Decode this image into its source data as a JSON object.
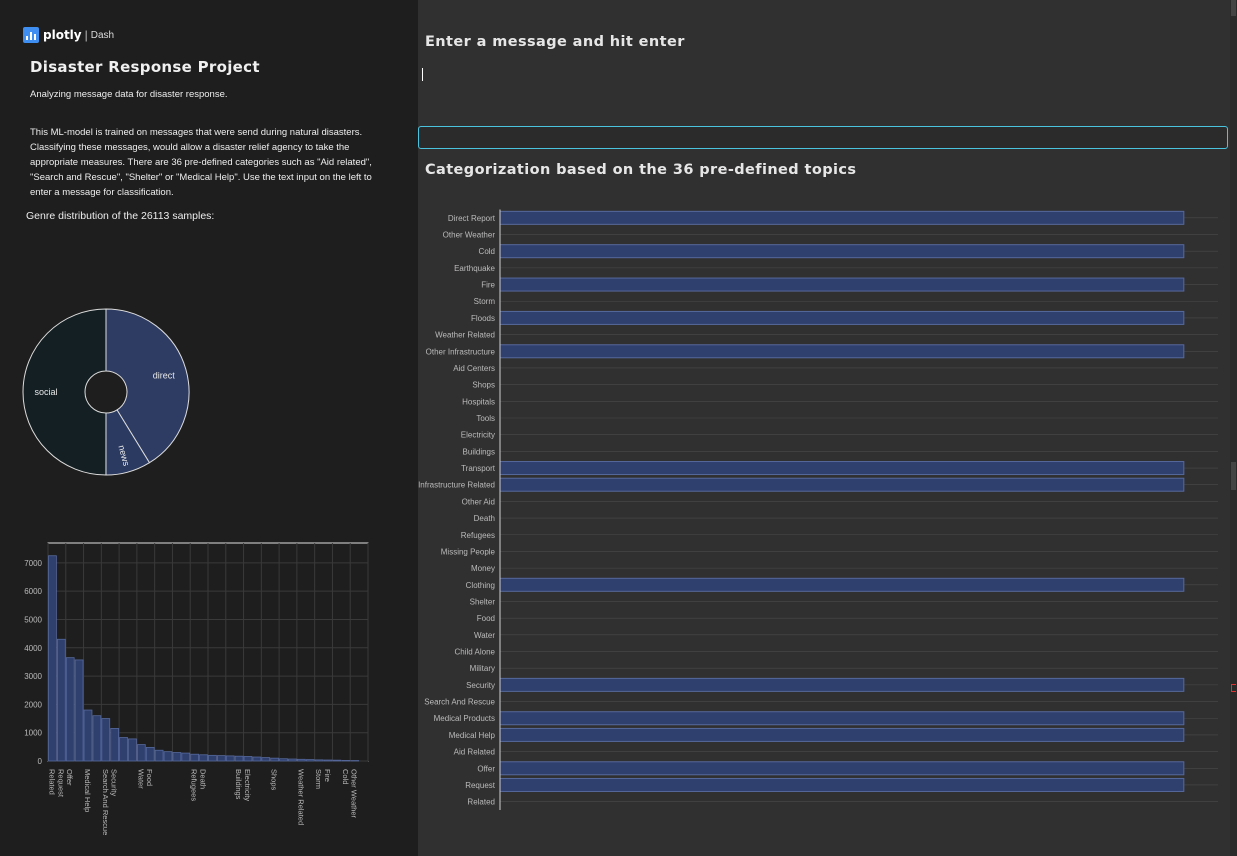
{
  "brand": {
    "logo_text": "plotly",
    "product": "Dash"
  },
  "sidebar": {
    "title": "Disaster Response Project",
    "subtitle": "Analyzing message data for disaster response.",
    "description": "This ML-model is trained on messages that were send during natural disasters. Classifying these messages, would allow a disaster relief agency to take the appropriate measures. There are 36 pre-defined categories such as \"Aid related\", \"Search and Rescue\", \"Shelter\" or \"Medical Help\". Use the text input on the left to enter a message for classification.",
    "genre_label": "Genre distribution of the 26113 samples:"
  },
  "main": {
    "input_label": "Enter a message and hit enter",
    "input_value": "",
    "categorization_title": "Categorization based on the 36 pre-defined topics"
  },
  "colors": {
    "bar_fill": "#2f3f6e",
    "bar_stroke": "#56699c",
    "social": "#131f23",
    "direct": "#2e3c63",
    "news": "#2b3a61",
    "accent": "#4ac3df"
  },
  "chart_data": [
    {
      "type": "pie",
      "hole": true,
      "labels": [
        "direct",
        "social",
        "news"
      ],
      "values": [
        10766,
        13054,
        2293
      ]
    },
    {
      "type": "bar",
      "categories": [
        "Related",
        "Request",
        "Offer",
        "Aid Related",
        "Medical Help",
        "Medical Products",
        "Search And Rescue",
        "Security",
        "Military",
        "Child Alone",
        "Water",
        "Food",
        "Shelter",
        "Clothing",
        "Money",
        "Missing People",
        "Refugees",
        "Death",
        "Other Aid",
        "Infrastructure Related",
        "Transport",
        "Buildings",
        "Electricity",
        "Tools",
        "Hospitals",
        "Shops",
        "Aid Centers",
        "Other Infrastructure",
        "Weather Related",
        "Floods",
        "Storm",
        "Fire",
        "Earthquake",
        "Cold",
        "Other Weather",
        "Direct Report"
      ],
      "values": [
        7250,
        4300,
        3650,
        3570,
        1800,
        1600,
        1500,
        1150,
        830,
        780,
        580,
        480,
        380,
        330,
        300,
        280,
        240,
        220,
        200,
        190,
        180,
        170,
        160,
        140,
        120,
        100,
        80,
        70,
        60,
        50,
        40,
        35,
        30,
        20,
        15,
        0
      ],
      "yticks": [
        0,
        1000,
        2000,
        3000,
        4000,
        5000,
        6000,
        7000
      ],
      "ylim": [
        0,
        7700
      ],
      "grid": true,
      "visible_tick_labels": [
        "Related",
        "Request",
        "Food",
        "Weather Related",
        "Water",
        "Medical Help",
        "Buildings",
        "Storm",
        "Death",
        "Search And Rescue",
        "Other Weather",
        "Refugees",
        "Security",
        "Electricity",
        "Cold",
        "Offer",
        "Fire",
        "Shops"
      ]
    },
    {
      "type": "bar",
      "orientation": "horizontal",
      "categories": [
        "Direct Report",
        "Other Weather",
        "Cold",
        "Earthquake",
        "Fire",
        "Storm",
        "Floods",
        "Weather Related",
        "Other Infrastructure",
        "Aid Centers",
        "Shops",
        "Hospitals",
        "Tools",
        "Electricity",
        "Buildings",
        "Transport",
        "Infrastructure Related",
        "Other Aid",
        "Death",
        "Refugees",
        "Missing People",
        "Money",
        "Clothing",
        "Shelter",
        "Food",
        "Water",
        "Child Alone",
        "Military",
        "Security",
        "Search And Rescue",
        "Medical Products",
        "Medical Help",
        "Aid Related",
        "Offer",
        "Request",
        "Related"
      ],
      "values": [
        1,
        0,
        1,
        0,
        1,
        0,
        1,
        0,
        1,
        0,
        0,
        0,
        0,
        0,
        0,
        1,
        1,
        0,
        0,
        0,
        0,
        0,
        1,
        0,
        0,
        0,
        0,
        0,
        1,
        0,
        1,
        1,
        0,
        1,
        1,
        0
      ],
      "xlim": [
        0,
        1.05
      ],
      "grid": true
    }
  ]
}
